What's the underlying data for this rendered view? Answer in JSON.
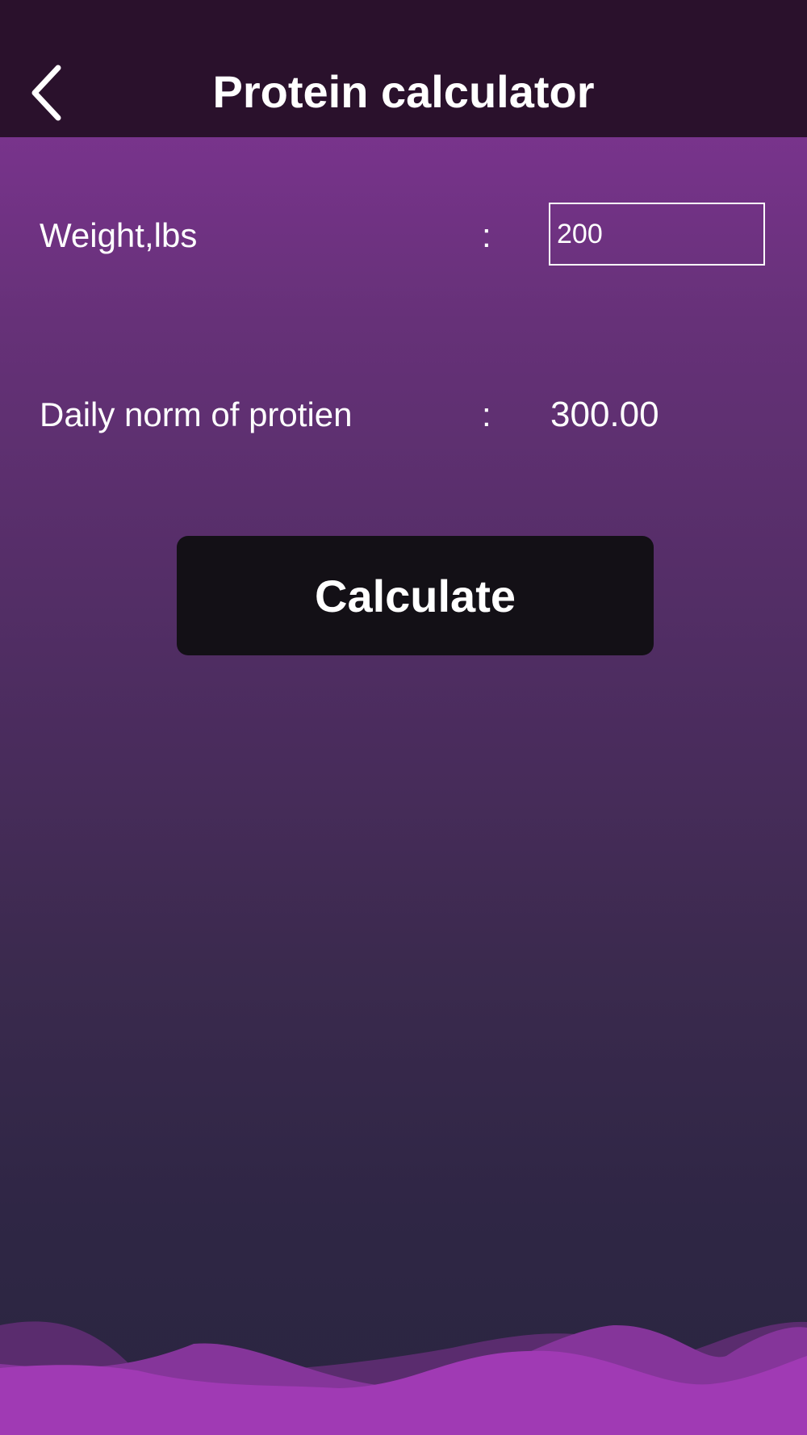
{
  "header": {
    "title": "Protein calculator",
    "back_icon": "chevron-left-icon"
  },
  "form": {
    "weight_label": "Weight,lbs",
    "weight_separator": ":",
    "weight_value": "200",
    "norm_label": "Daily norm of protien",
    "norm_separator": ":",
    "norm_value": "300.00"
  },
  "actions": {
    "calculate_label": "Calculate"
  },
  "colors": {
    "header_bg": "#2a112c",
    "button_bg": "#131016",
    "wave_front": "#a03ab4",
    "wave_mid": "#85359a",
    "wave_back": "#5a2c6e"
  }
}
